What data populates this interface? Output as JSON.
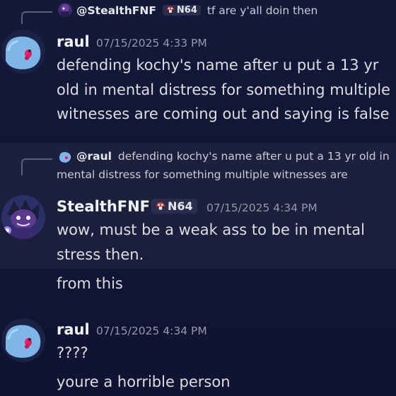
{
  "messages": [
    {
      "reply": {
        "name": "@StealthFNF",
        "badge": "N64",
        "text": "tf are y'all doin then"
      },
      "author": "raul",
      "timestamp": "07/15/2025 4:33 PM",
      "lines": [
        "defending kochy's name after u put a 13 yr",
        "old in mental distress for something multiple",
        "witnesses are coming out and saying is false"
      ]
    },
    {
      "reply": {
        "name": "@raul",
        "text_line1": "defending kochy's name after u put a 13 yr old in",
        "text_line2": "mental distress for something multiple witnesses are"
      },
      "author": "StealthFNF",
      "badge": "N64",
      "timestamp": "07/15/2025 4:34 PM",
      "lines": [
        "wow, must be a weak ass to be in mental",
        "stress then."
      ],
      "followup": "from this"
    },
    {
      "author": "raul",
      "timestamp": "07/15/2025 4:34 PM",
      "lines": [
        "????",
        "youre a horrible person"
      ]
    }
  ],
  "colors": {
    "background": "#121634",
    "username": "#f2f3f5",
    "timestamp": "#9498aa",
    "badge_bg": "#2a2d4c",
    "reply_line": "#5c6080",
    "raul_avatar": "#7fb6e8"
  },
  "icons": {
    "badge_icon": "mushroom-icon",
    "raul_avatar": "blue-creature-avatar",
    "stealth_avatar": "purple-character-avatar"
  }
}
